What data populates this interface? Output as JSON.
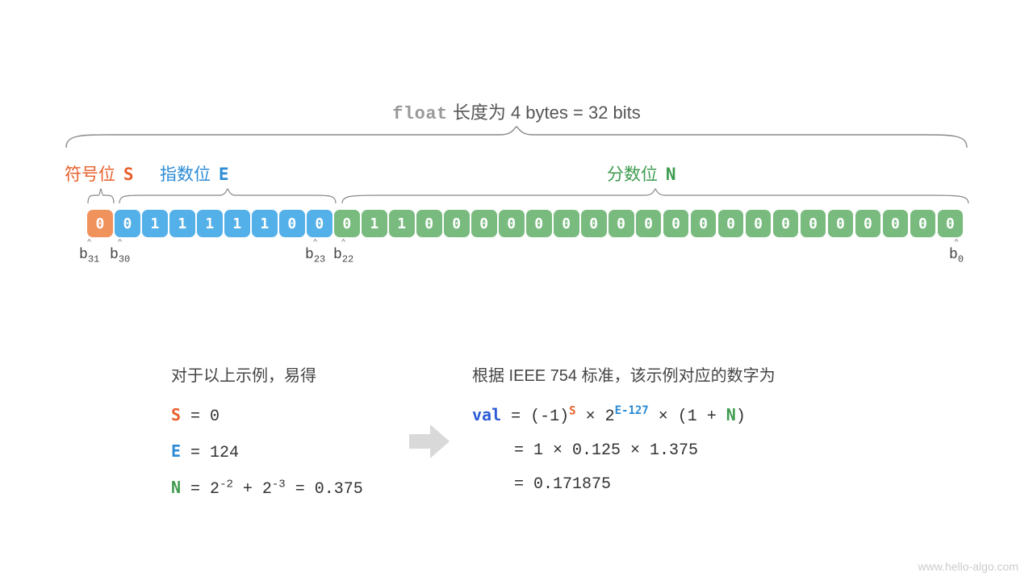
{
  "title": {
    "keyword": "float",
    "rest": " 长度为 4 bytes = 32 bits"
  },
  "sections": {
    "sign": {
      "label": "符号位",
      "letter": "S"
    },
    "exponent": {
      "label": "指数位",
      "letter": "E"
    },
    "fraction": {
      "label": "分数位",
      "letter": "N"
    }
  },
  "bits": {
    "sign": [
      "0"
    ],
    "exponent": [
      "0",
      "1",
      "1",
      "1",
      "1",
      "1",
      "0",
      "0"
    ],
    "fraction": [
      "0",
      "1",
      "1",
      "0",
      "0",
      "0",
      "0",
      "0",
      "0",
      "0",
      "0",
      "0",
      "0",
      "0",
      "0",
      "0",
      "0",
      "0",
      "0",
      "0",
      "0",
      "0",
      "0"
    ]
  },
  "bit_indices": {
    "b31": "b",
    "b31_sub": "31",
    "b30": "b",
    "b30_sub": "30",
    "b23": "b",
    "b23_sub": "23",
    "b22": "b",
    "b22_sub": "22",
    "b0": "b",
    "b0_sub": "0"
  },
  "left": {
    "hdr": "对于以上示例，易得",
    "s_eq": " = 0",
    "e_eq": " = 124",
    "n_eq_a": " = 2",
    "n_eq_exp1": "-2",
    "n_eq_plus": " + 2",
    "n_eq_exp2": "-3",
    "n_eq_rest": " = 0.375"
  },
  "right": {
    "hdr": "根据 IEEE 754 标准，该示例对应的数字为",
    "val": "val",
    "line1_a": " = (-1)",
    "line1_b": " × 2",
    "line1_exp": "E-127",
    "line1_c": " × (1 + ",
    "line1_d": ")",
    "line2": "= 1 × 0.125 × 1.375",
    "line3": "= 0.171875"
  },
  "watermark": "www.hello-algo.com"
}
